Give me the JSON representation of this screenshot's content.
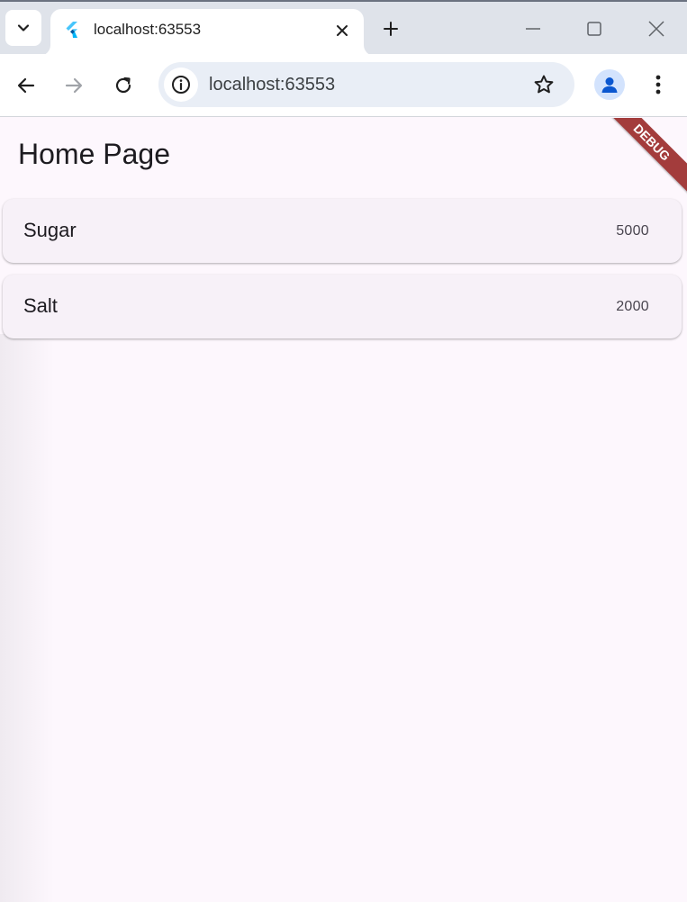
{
  "browser": {
    "tab": {
      "title": "localhost:63553"
    },
    "address_bar": {
      "url": "localhost:63553"
    }
  },
  "app": {
    "title": "Home Page",
    "debug_banner": "DEBUG",
    "items": [
      {
        "name": "Sugar",
        "value": "5000"
      },
      {
        "name": "Salt",
        "value": "2000"
      }
    ]
  },
  "icons": {
    "tab_search": "chevron-down-icon",
    "favicon": "flutter-icon",
    "tab_close": "close-icon",
    "new_tab": "plus-icon",
    "minimize": "minimize-icon",
    "maximize": "maximize-icon",
    "close_window": "close-icon",
    "back": "arrow-left-icon",
    "forward": "arrow-right-icon",
    "reload": "reload-icon",
    "site_info": "info-icon",
    "bookmark": "star-icon",
    "profile": "person-icon",
    "menu": "more-vert-icon"
  },
  "colors": {
    "tabstrip": "#dfe3ea",
    "app_background": "#fdf7fd",
    "card_background": "#f7f1f8",
    "debug_banner": "#a33c3c",
    "avatar": "#0b57d0"
  }
}
